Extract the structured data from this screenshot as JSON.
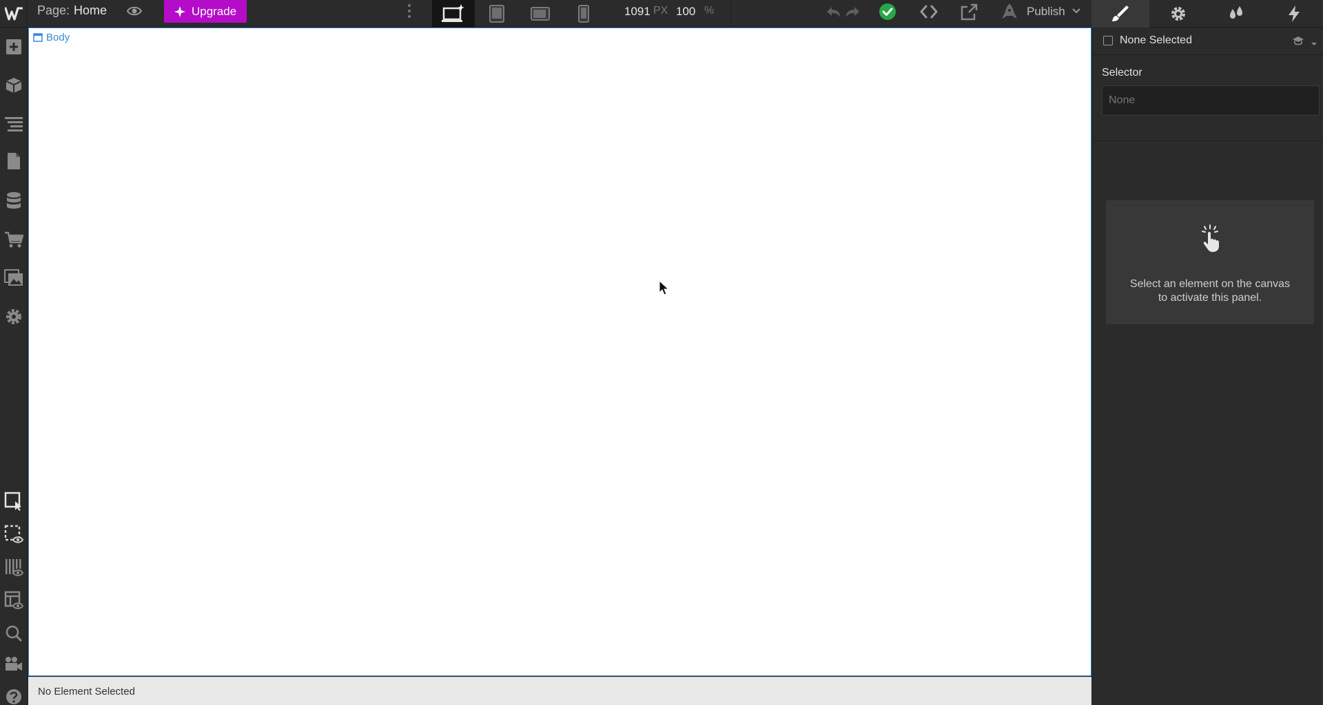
{
  "topbar": {
    "page_label": "Page:",
    "page_name": "Home",
    "upgrade_label": "Upgrade",
    "width_value": "1091",
    "width_unit": "PX",
    "zoom_value": "100",
    "zoom_unit": "%",
    "publish_label": "Publish"
  },
  "canvas": {
    "body_tag": "Body"
  },
  "footer": {
    "status": "No Element Selected"
  },
  "panel": {
    "selection_label": "None Selected",
    "selector_title": "Selector",
    "selector_placeholder": "None",
    "empty_message_line1": "Select an element on the canvas",
    "empty_message_line2": "to activate this panel."
  },
  "colors": {
    "accent": "#3c89d6",
    "upgrade": "#b40cc8",
    "success": "#28a745"
  }
}
